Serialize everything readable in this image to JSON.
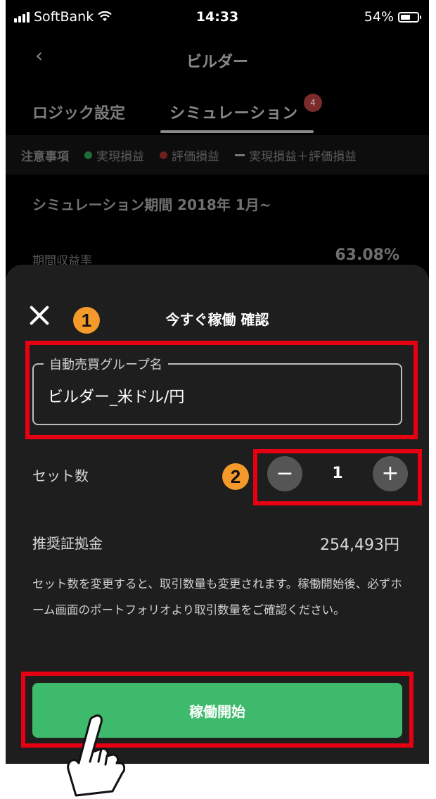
{
  "status_bar": {
    "carrier": "SoftBank",
    "time": "14:33",
    "battery": "54%"
  },
  "nav": {
    "title": "ビルダー"
  },
  "tabs": [
    {
      "label": "ロジック設定"
    },
    {
      "label": "シミュレーション",
      "badge": "4"
    }
  ],
  "legend": {
    "notice": "注意事項",
    "items": [
      "実現損益",
      "評価損益",
      "実現損益＋評価損益"
    ],
    "colors": [
      "#1f6b3a",
      "#6b1f1f",
      "#777777"
    ]
  },
  "simulation": {
    "period": "シミュレーション期間 2018年 1月~",
    "metric_label": "期間収益率",
    "metric_value": "63.08%"
  },
  "modal": {
    "title": "今すぐ稼働 確認",
    "group_name_label": "自動売買グループ名",
    "group_name_value": "ビルダー_米ドル/円",
    "sets_label": "セット数",
    "sets_value": "1",
    "minus": "−",
    "plus": "+",
    "margin_label": "推奨証拠金",
    "margin_value": "254,493円",
    "note": "セット数を変更すると、取引数量も変更されます。稼働開始後、必ずホーム画面のポートフォリオより取引数量をご確認ください。",
    "start_button": "稼働開始"
  },
  "callouts": [
    "1",
    "2"
  ],
  "colors": {
    "accent_green": "#3dba6c",
    "highlight_red": "#e60012",
    "callout_orange": "#f39a2b"
  }
}
